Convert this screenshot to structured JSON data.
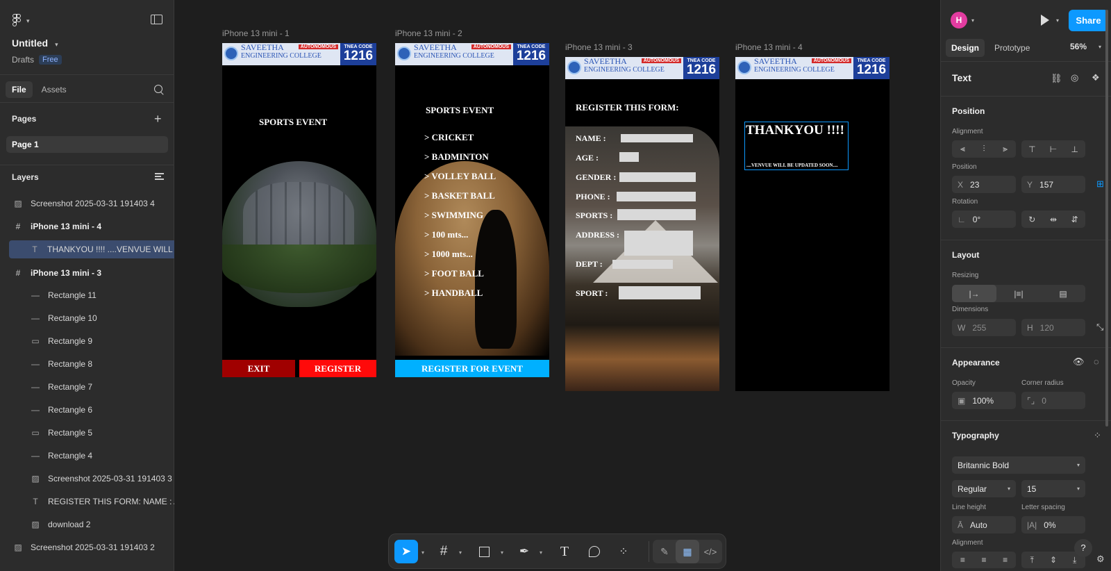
{
  "app": {
    "file_title": "Untitled",
    "drafts_label": "Drafts",
    "plan_badge": "Free"
  },
  "left": {
    "tabs": [
      "File",
      "Assets"
    ],
    "pages_heading": "Pages",
    "page_item": "Page 1",
    "layers_heading": "Layers",
    "layers": [
      {
        "icon": "image-icon",
        "label": "Screenshot 2025-03-31 191403 4",
        "indent": 0,
        "frame": false,
        "selected": false
      },
      {
        "icon": "frame-icon",
        "label": "iPhone 13 mini - 4",
        "indent": 0,
        "frame": true,
        "selected": false
      },
      {
        "icon": "text-icon",
        "label": "THANKYOU !!!! ....VENVUE WILL BE UPDATED SOON....",
        "indent": 1,
        "frame": false,
        "selected": true
      },
      {
        "icon": "frame-icon",
        "label": "iPhone 13 mini - 3",
        "indent": 0,
        "frame": true,
        "selected": false
      },
      {
        "icon": "line-icon",
        "label": "Rectangle 11",
        "indent": 1,
        "frame": false,
        "selected": false
      },
      {
        "icon": "line-icon",
        "label": "Rectangle 10",
        "indent": 1,
        "frame": false,
        "selected": false
      },
      {
        "icon": "rectangle-icon",
        "label": "Rectangle 9",
        "indent": 1,
        "frame": false,
        "selected": false
      },
      {
        "icon": "line-icon",
        "label": "Rectangle 8",
        "indent": 1,
        "frame": false,
        "selected": false
      },
      {
        "icon": "line-icon",
        "label": "Rectangle 7",
        "indent": 1,
        "frame": false,
        "selected": false
      },
      {
        "icon": "line-icon",
        "label": "Rectangle 6",
        "indent": 1,
        "frame": false,
        "selected": false
      },
      {
        "icon": "rectangle-icon",
        "label": "Rectangle 5",
        "indent": 1,
        "frame": false,
        "selected": false
      },
      {
        "icon": "line-icon",
        "label": "Rectangle 4",
        "indent": 1,
        "frame": false,
        "selected": false
      },
      {
        "icon": "image-icon",
        "label": "Screenshot 2025-03-31 191403 3",
        "indent": 1,
        "frame": false,
        "selected": false
      },
      {
        "icon": "text-icon",
        "label": "REGISTER THIS FORM: NAME : AGE :",
        "indent": 1,
        "frame": false,
        "selected": false
      },
      {
        "icon": "image-icon",
        "label": "download 2",
        "indent": 1,
        "frame": false,
        "selected": false
      },
      {
        "icon": "image-icon",
        "label": "Screenshot 2025-03-31 191403 2",
        "indent": 0,
        "frame": false,
        "selected": false
      }
    ]
  },
  "canvas": {
    "frames": [
      {
        "label": "iPhone 13 mini - 1"
      },
      {
        "label": "iPhone 13 mini - 2"
      },
      {
        "label": "iPhone 13 mini - 3"
      },
      {
        "label": "iPhone 13 mini - 4"
      }
    ],
    "college": {
      "name_line1": "SAVEETHA",
      "name_line2": "ENGINEERING COLLEGE",
      "autonomous": "AUTONOMOUS",
      "tnea_label": "TNEA CODE",
      "tnea_code": "1216"
    },
    "phone1": {
      "title": "SPORTS    EVENT",
      "exit": "EXIT",
      "register": "REGISTER"
    },
    "phone2": {
      "title": "SPORTS   EVENT",
      "items": [
        "> CRICKET",
        "> BADMINTON",
        "> VOLLEY BALL",
        "> BASKET BALL",
        "> SWIMMING",
        "> 100 mts...",
        "> 1000 mts...",
        ">  FOOT BALL",
        "> HANDBALL"
      ],
      "button": "REGISTER FOR EVENT"
    },
    "phone3": {
      "title": "REGISTER THIS FORM:",
      "fields": [
        "NAME :",
        "AGE :",
        "GENDER :",
        "PHONE :",
        "SPORTS :",
        "ADDRESS :",
        "DEPT :",
        "SPORT :"
      ]
    },
    "phone4": {
      "title": "THANKYOU !!!!",
      "subtitle": "....VENVUE WILL BE UPDATED SOON...."
    }
  },
  "right": {
    "avatar_initial": "H",
    "share": "Share",
    "tabs": [
      "Design",
      "Prototype"
    ],
    "zoom": "56%",
    "selection_type": "Text",
    "position": {
      "heading": "Position",
      "alignment_label": "Alignment",
      "position_label": "Position",
      "x_label": "X",
      "x": "23",
      "y_label": "Y",
      "y": "157",
      "rotation_label": "Rotation",
      "rotation": "0°"
    },
    "layout": {
      "heading": "Layout",
      "resizing_label": "Resizing",
      "dimensions_label": "Dimensions",
      "w_label": "W",
      "w": "255",
      "h_label": "H",
      "h": "120"
    },
    "appearance": {
      "heading": "Appearance",
      "opacity_label": "Opacity",
      "opacity": "100%",
      "radius_label": "Corner radius",
      "radius": "0"
    },
    "typography": {
      "heading": "Typography",
      "font": "Britannic Bold",
      "weight": "Regular",
      "size": "15",
      "line_height_label": "Line height",
      "line_height": "Auto",
      "letter_spacing_label": "Letter spacing",
      "letter_spacing": "0%",
      "alignment_label": "Alignment"
    },
    "help": "?"
  },
  "colors": {
    "accent": "#0d99ff",
    "avatar": "#e23ca0",
    "selection": "#3b4c6e"
  }
}
